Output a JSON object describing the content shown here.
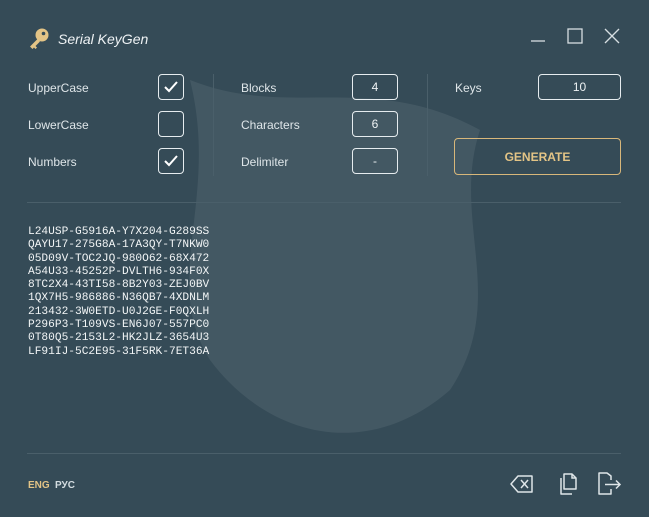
{
  "app": {
    "title": "Serial KeyGen",
    "icon": "key-icon",
    "window_controls": [
      "minimize-icon",
      "maximize-icon",
      "close-icon"
    ]
  },
  "options": {
    "uppercase": {
      "label": "UpperCase",
      "checked": true
    },
    "lowercase": {
      "label": "LowerCase",
      "checked": false
    },
    "numbers": {
      "label": "Numbers",
      "checked": true
    }
  },
  "format": {
    "blocks": {
      "label": "Blocks",
      "value": "4"
    },
    "characters": {
      "label": "Characters",
      "value": "6"
    },
    "delimiter": {
      "label": "Delimiter",
      "value": "-"
    }
  },
  "keys": {
    "label": "Keys",
    "value": "10"
  },
  "generate_label": "GENERATE",
  "output": [
    "L24USP-G5916A-Y7X204-G289SS",
    "QAYU17-275G8A-17A3QY-T7NKW0",
    "05D09V-TOC2JQ-980O62-68X472",
    "A54U33-45252P-DVLTH6-934F0X",
    "8TC2X4-43TI58-8B2Y03-ZEJ0BV",
    "1QX7H5-986886-N36QB7-4XDNLM",
    "213432-3W0ETD-U0J2GE-F0QXLH",
    "P296P3-T109VS-EN6J07-557PC0",
    "0T80Q5-2153L2-HK2JLZ-3654U3",
    "LF91IJ-5C2E95-31F5RK-7ET36A"
  ],
  "language": {
    "english": "ENG",
    "russian": "РУС",
    "active": "ENG"
  },
  "actions": [
    "clear-icon",
    "copy-icon",
    "export-icon"
  ],
  "colors": {
    "background": "#354b57",
    "accent": "#e3c486",
    "text": "#dfe6e9",
    "border": "#e6ecef"
  }
}
